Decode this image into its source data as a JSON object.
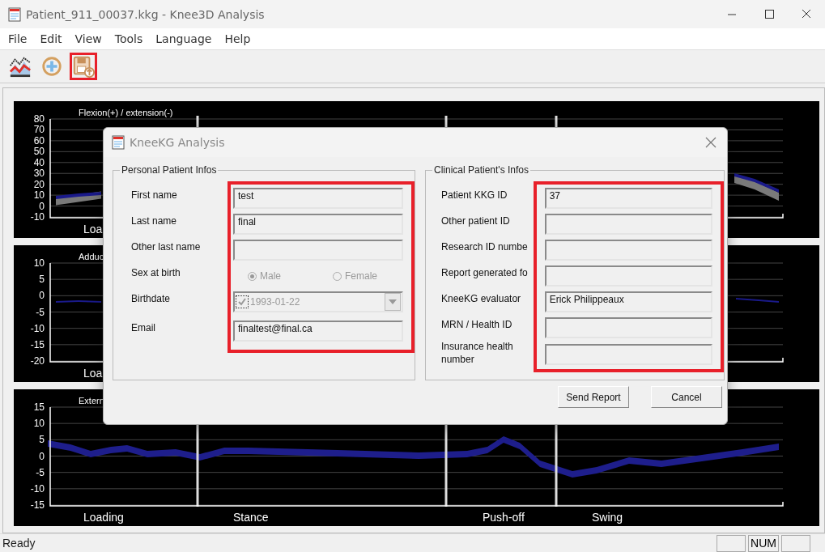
{
  "window": {
    "title": "Patient_911_00037.kkg - Knee3D Analysis"
  },
  "menu": [
    "File",
    "Edit",
    "View",
    "Tools",
    "Language",
    "Help"
  ],
  "toolbar": [
    {
      "kind": "chart",
      "highlighted": false
    },
    {
      "kind": "refresh",
      "highlighted": false
    },
    {
      "kind": "save",
      "highlighted": true
    }
  ],
  "charts": [
    {
      "title": "Flexion(+) / extension(-)",
      "yticks": [
        "80",
        "70",
        "60",
        "50",
        "40",
        "30",
        "20",
        "10",
        "0",
        "-10"
      ],
      "phases": [
        {
          "label": "Loa",
          "kind": "loading"
        }
      ],
      "kind": "flexion"
    },
    {
      "title": "Adduc",
      "yticks": [
        "10",
        "5",
        "0",
        "-5",
        "-10",
        "-15",
        "-20"
      ],
      "phases": [
        {
          "label": "Loa",
          "kind": "loading"
        }
      ],
      "kind": "adduction"
    },
    {
      "title": "Extern",
      "yticks": [
        "15",
        "10",
        "5",
        "0",
        "-5",
        "-10",
        "-15"
      ],
      "phases": [
        {
          "label": "Loading",
          "kind": "loading"
        },
        {
          "label": "Stance",
          "kind": "stance"
        },
        {
          "label": "Push-off",
          "kind": "pushoff"
        },
        {
          "label": "Swing",
          "kind": "swing"
        }
      ],
      "kind": "rotation"
    }
  ],
  "dialog": {
    "title": "KneeKG Analysis",
    "groups": [
      {
        "title": "Personal Patient Infos",
        "highlighted": true,
        "rows": [
          {
            "kind": "text",
            "label": "First name",
            "value": "test"
          },
          {
            "kind": "text",
            "label": "Last name",
            "value": "final"
          },
          {
            "kind": "text",
            "label": "Other last name",
            "value": ""
          },
          {
            "kind": "radio",
            "label": "Sex at birth",
            "disabled": true,
            "options": [
              {
                "label": "Male",
                "selected": true
              },
              {
                "label": "Female",
                "selected": false
              }
            ]
          },
          {
            "kind": "date",
            "label": "Birthdate",
            "value": "1993-01-22",
            "checked": true,
            "disabled": true
          },
          {
            "kind": "text",
            "label": "Email",
            "value": "finaltest@final.ca"
          }
        ]
      },
      {
        "title": "Clinical Patient's Infos",
        "highlighted": true,
        "rows": [
          {
            "kind": "text",
            "label": "Patient KKG ID",
            "value": "37"
          },
          {
            "kind": "text",
            "label": "Other patient ID",
            "value": ""
          },
          {
            "kind": "text",
            "label": "Research ID numbe",
            "value": ""
          },
          {
            "kind": "text",
            "label": "Report generated fo",
            "value": ""
          },
          {
            "kind": "text",
            "label": "KneeKG evaluator",
            "value": "Erick Philippeaux"
          },
          {
            "kind": "text",
            "label": "MRN / Health ID",
            "value": ""
          },
          {
            "kind": "text",
            "label": "Insurance health number",
            "value": ""
          }
        ]
      }
    ],
    "buttons": [
      "Send Report",
      "Cancel"
    ]
  },
  "status_bar": {
    "text": "Ready",
    "panes": [
      {
        "kind": "blank"
      },
      {
        "kind": "text",
        "text": "NUM"
      },
      {
        "kind": "blank"
      }
    ]
  }
}
